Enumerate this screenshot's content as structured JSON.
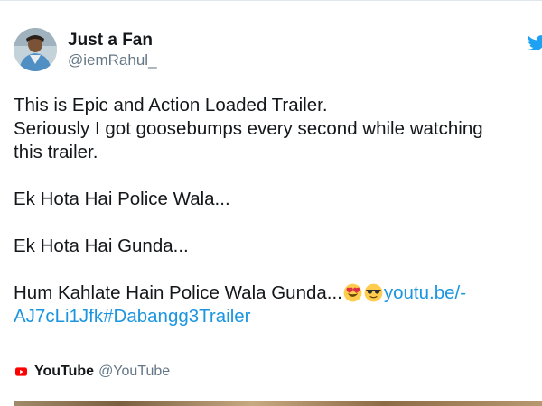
{
  "tweet": {
    "author_name": "Just a Fan",
    "author_handle": "@iemRahul_",
    "text_line_1": "This is Epic and Action Loaded Trailer.",
    "text_line_2": "Seriously I got goosebumps every second while watching",
    "text_line_3": "this trailer.",
    "text_line_4": "Ek Hota Hai Police Wala...",
    "text_line_5": "Ek Hota Hai Gunda...",
    "text_line_6": "Hum Kahlate Hain Police Wala Gunda...",
    "link_part_1": "youtu.be/-",
    "link_part_2": "AJ7cLi1Jfk",
    "hashtag": "#Dabangg3Trailer",
    "emojis": [
      "heart-eyes-face",
      "sunglasses-face"
    ]
  },
  "source": {
    "name": "YouTube",
    "handle": "@YouTube",
    "icon": "youtube-icon"
  },
  "icons": {
    "platform": "twitter-bird-icon"
  },
  "colors": {
    "link": "#1b95e0",
    "text": "#14171a",
    "secondary_text": "#657786",
    "youtube_red": "#ff0000",
    "twitter_blue": "#1da1f2"
  }
}
